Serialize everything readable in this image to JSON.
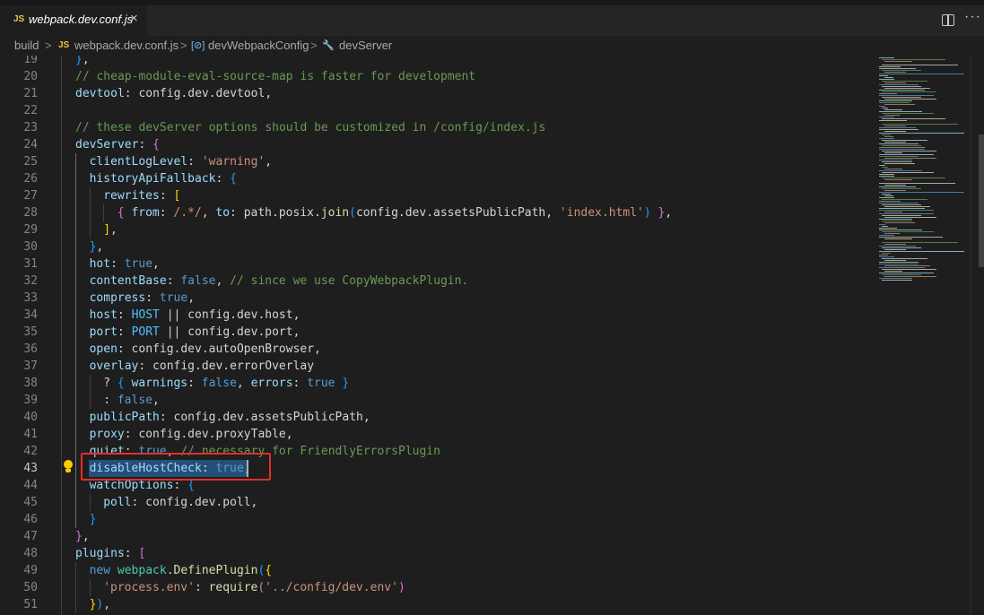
{
  "tab": {
    "icon": "JS",
    "name": "webpack.dev.conf.js",
    "close": "×"
  },
  "actions": {
    "split_label": "Split Editor",
    "more": "···"
  },
  "breadcrumb": {
    "items": [
      {
        "label": "build"
      },
      {
        "sep": ">"
      },
      {
        "icon": "JS",
        "label": "webpack.dev.conf.js"
      },
      {
        "sep": ">"
      },
      {
        "icon": "[⊘]",
        "label": "devWebpackConfig"
      },
      {
        "sep": ">"
      },
      {
        "icon": "🔧",
        "label": "devServer"
      }
    ]
  },
  "editor": {
    "active_line": 43,
    "lines": [
      {
        "n": 19,
        "indent": 0,
        "tokens": [
          [
            "b3",
            "}"
          ],
          [
            "p",
            ","
          ]
        ]
      },
      {
        "n": 20,
        "indent": 0,
        "tokens": [
          [
            "cmt",
            "// cheap-module-eval-source-map is faster for development"
          ]
        ]
      },
      {
        "n": 21,
        "indent": 0,
        "tokens": [
          [
            "prop",
            "devtool"
          ],
          [
            "p",
            ": config.dev.devtool,"
          ]
        ]
      },
      {
        "n": 22,
        "indent": 0,
        "tokens": []
      },
      {
        "n": 23,
        "indent": 0,
        "tokens": [
          [
            "cmt",
            "// these devServer options should be customized in /config/index.js"
          ]
        ]
      },
      {
        "n": 24,
        "indent": 0,
        "tokens": [
          [
            "prop",
            "devServer"
          ],
          [
            "p",
            ": "
          ],
          [
            "b2",
            "{"
          ]
        ]
      },
      {
        "n": 25,
        "indent": 1,
        "tokens": [
          [
            "prop",
            "clientLogLevel"
          ],
          [
            "p",
            ": "
          ],
          [
            "str",
            "'warning'"
          ],
          [
            "p",
            ","
          ]
        ]
      },
      {
        "n": 26,
        "indent": 1,
        "tokens": [
          [
            "prop",
            "historyApiFallback"
          ],
          [
            "p",
            ": "
          ],
          [
            "b3",
            "{"
          ]
        ]
      },
      {
        "n": 27,
        "indent": 2,
        "tokens": [
          [
            "prop",
            "rewrites"
          ],
          [
            "p",
            ": "
          ],
          [
            "b1",
            "["
          ]
        ]
      },
      {
        "n": 28,
        "indent": 3,
        "tokens": [
          [
            "b2",
            "{"
          ],
          [
            "p",
            " "
          ],
          [
            "prop",
            "from"
          ],
          [
            "p",
            ": "
          ],
          [
            "str",
            "/.*/"
          ],
          [
            "p",
            ", "
          ],
          [
            "prop",
            "to"
          ],
          [
            "p",
            ": path.posix."
          ],
          [
            "fn",
            "join"
          ],
          [
            "b3",
            "("
          ],
          [
            "p",
            "config.dev.assetsPublicPath, "
          ],
          [
            "str",
            "'index.html'"
          ],
          [
            "b3",
            ")"
          ],
          [
            "p",
            " "
          ],
          [
            "b2",
            "}"
          ],
          [
            "p",
            ","
          ]
        ]
      },
      {
        "n": 29,
        "indent": 2,
        "tokens": [
          [
            "b1",
            "]"
          ],
          [
            "p",
            ","
          ]
        ]
      },
      {
        "n": 30,
        "indent": 1,
        "tokens": [
          [
            "b3",
            "}"
          ],
          [
            "p",
            ","
          ]
        ]
      },
      {
        "n": 31,
        "indent": 1,
        "tokens": [
          [
            "prop",
            "hot"
          ],
          [
            "p",
            ": "
          ],
          [
            "kw",
            "true"
          ],
          [
            "p",
            ","
          ]
        ]
      },
      {
        "n": 32,
        "indent": 1,
        "tokens": [
          [
            "prop",
            "contentBase"
          ],
          [
            "p",
            ": "
          ],
          [
            "kw",
            "false"
          ],
          [
            "p",
            ", "
          ],
          [
            "cmt",
            "// since we use CopyWebpackPlugin."
          ]
        ]
      },
      {
        "n": 33,
        "indent": 1,
        "tokens": [
          [
            "prop",
            "compress"
          ],
          [
            "p",
            ": "
          ],
          [
            "kw",
            "true"
          ],
          [
            "p",
            ","
          ]
        ]
      },
      {
        "n": 34,
        "indent": 1,
        "tokens": [
          [
            "prop",
            "host"
          ],
          [
            "p",
            ": "
          ],
          [
            "const",
            "HOST"
          ],
          [
            "p",
            " || config.dev.host,"
          ]
        ]
      },
      {
        "n": 35,
        "indent": 1,
        "tokens": [
          [
            "prop",
            "port"
          ],
          [
            "p",
            ": "
          ],
          [
            "const",
            "PORT"
          ],
          [
            "p",
            " || config.dev.port,"
          ]
        ]
      },
      {
        "n": 36,
        "indent": 1,
        "tokens": [
          [
            "prop",
            "open"
          ],
          [
            "p",
            ": config.dev.autoOpenBrowser,"
          ]
        ]
      },
      {
        "n": 37,
        "indent": 1,
        "tokens": [
          [
            "prop",
            "overlay"
          ],
          [
            "p",
            ": config.dev.errorOverlay"
          ]
        ]
      },
      {
        "n": 38,
        "indent": 2,
        "tokens": [
          [
            "p",
            "? "
          ],
          [
            "b3",
            "{"
          ],
          [
            "p",
            " "
          ],
          [
            "prop",
            "warnings"
          ],
          [
            "p",
            ": "
          ],
          [
            "kw",
            "false"
          ],
          [
            "p",
            ", "
          ],
          [
            "prop",
            "errors"
          ],
          [
            "p",
            ": "
          ],
          [
            "kw",
            "true"
          ],
          [
            "p",
            " "
          ],
          [
            "b3",
            "}"
          ]
        ]
      },
      {
        "n": 39,
        "indent": 2,
        "tokens": [
          [
            "p",
            ": "
          ],
          [
            "kw",
            "false"
          ],
          [
            "p",
            ","
          ]
        ]
      },
      {
        "n": 40,
        "indent": 1,
        "tokens": [
          [
            "prop",
            "publicPath"
          ],
          [
            "p",
            ": config.dev.assetsPublicPath,"
          ]
        ]
      },
      {
        "n": 41,
        "indent": 1,
        "tokens": [
          [
            "prop",
            "proxy"
          ],
          [
            "p",
            ": config.dev.proxyTable,"
          ]
        ]
      },
      {
        "n": 42,
        "indent": 1,
        "tokens": [
          [
            "prop",
            "quiet"
          ],
          [
            "p",
            ": "
          ],
          [
            "kw",
            "true"
          ],
          [
            "p",
            ", "
          ],
          [
            "cmt",
            "// necessary for FriendlyErrorsPlugin"
          ]
        ]
      },
      {
        "n": 43,
        "indent": 1,
        "tokens": [
          [
            "prop",
            "disableHostCheck"
          ],
          [
            "p",
            ": "
          ],
          [
            "kw",
            "true"
          ],
          [
            "p",
            ","
          ]
        ]
      },
      {
        "n": 44,
        "indent": 1,
        "tokens": [
          [
            "prop",
            "watchOptions"
          ],
          [
            "p",
            ": "
          ],
          [
            "b3",
            "{"
          ]
        ]
      },
      {
        "n": 45,
        "indent": 2,
        "tokens": [
          [
            "prop",
            "poll"
          ],
          [
            "p",
            ": config.dev.poll,"
          ]
        ]
      },
      {
        "n": 46,
        "indent": 1,
        "tokens": [
          [
            "b3",
            "}"
          ]
        ]
      },
      {
        "n": 47,
        "indent": 0,
        "tokens": [
          [
            "b2",
            "}"
          ],
          [
            "p",
            ","
          ]
        ]
      },
      {
        "n": 48,
        "indent": 0,
        "tokens": [
          [
            "prop",
            "plugins"
          ],
          [
            "p",
            ": "
          ],
          [
            "b2",
            "["
          ]
        ]
      },
      {
        "n": 49,
        "indent": 1,
        "tokens": [
          [
            "kw",
            "new"
          ],
          [
            "p",
            " "
          ],
          [
            "cls",
            "webpack"
          ],
          [
            "p",
            "."
          ],
          [
            "fn",
            "DefinePlugin"
          ],
          [
            "b3",
            "("
          ],
          [
            "b1",
            "{"
          ]
        ]
      },
      {
        "n": 50,
        "indent": 2,
        "tokens": [
          [
            "str",
            "'process.env'"
          ],
          [
            "p",
            ": "
          ],
          [
            "fn",
            "require"
          ],
          [
            "b2",
            "("
          ],
          [
            "str",
            "'../config/dev.env'"
          ],
          [
            "b2",
            ")"
          ]
        ]
      },
      {
        "n": 51,
        "indent": 1,
        "tokens": [
          [
            "b1",
            "}"
          ],
          [
            "b3",
            ")"
          ],
          [
            "p",
            ","
          ]
        ]
      }
    ]
  },
  "colors": {
    "background": "#1e1e1e",
    "selection": "#264f78",
    "highlight_box": "#e0302a",
    "lightbulb": "#ffcc00"
  }
}
